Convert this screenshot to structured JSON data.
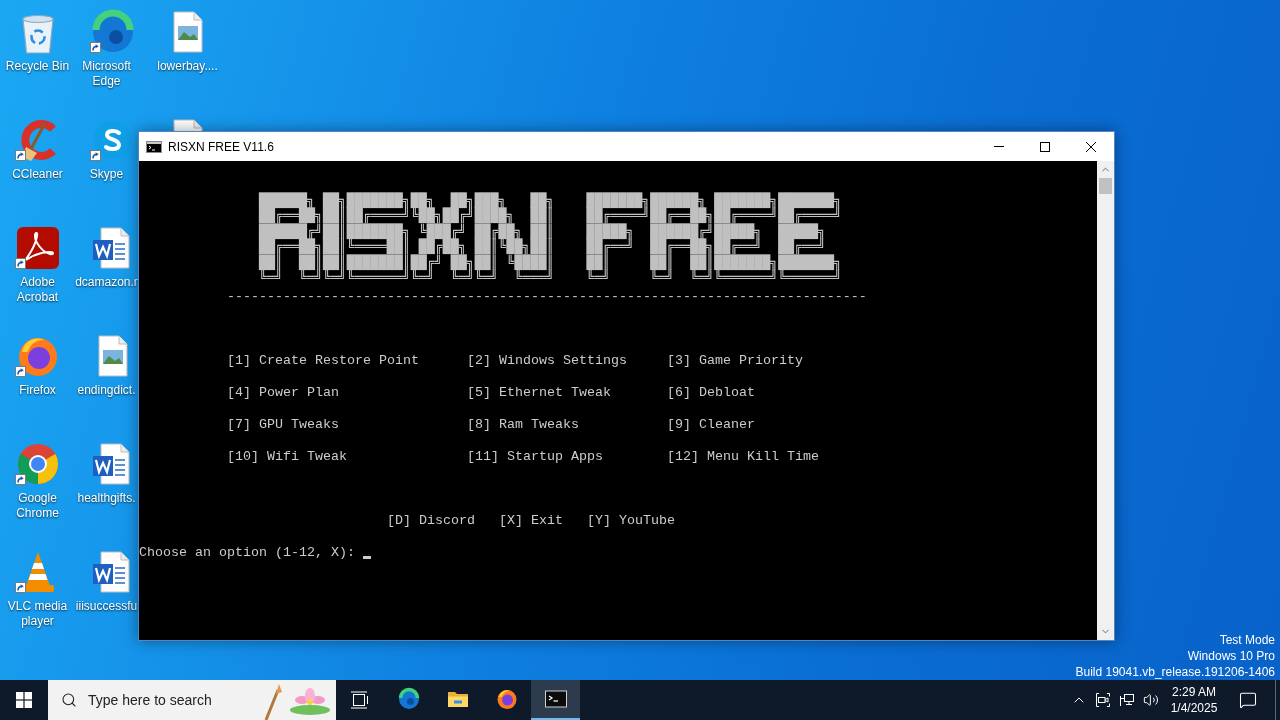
{
  "desktop": {
    "columns": [
      [
        {
          "kind": "recycle-bin",
          "label": "Recycle Bin",
          "shortcut": false,
          "clipped": false
        },
        {
          "kind": "ccleaner",
          "label": "CCleaner",
          "shortcut": true,
          "clipped": false
        },
        {
          "kind": "acrobat",
          "label": "Adobe Acrobat",
          "shortcut": true,
          "clipped": false
        },
        {
          "kind": "firefox",
          "label": "Firefox",
          "shortcut": true,
          "clipped": false
        },
        {
          "kind": "chrome",
          "label": "Google Chrome",
          "shortcut": true,
          "clipped": false
        },
        {
          "kind": "vlc",
          "label": "VLC media player",
          "shortcut": true,
          "clipped": false
        }
      ],
      [
        {
          "kind": "edge",
          "label": "Microsoft Edge",
          "shortcut": true,
          "clipped": false
        },
        {
          "kind": "skype",
          "label": "Skype",
          "shortcut": true,
          "clipped": false
        },
        {
          "kind": "word-doc",
          "label": "dcamazon.r",
          "shortcut": false,
          "clipped": false
        },
        {
          "kind": "image-file",
          "label": "endingdict.",
          "shortcut": false,
          "clipped": false
        },
        {
          "kind": "word-doc",
          "label": "healthgifts.",
          "shortcut": false,
          "clipped": false
        },
        {
          "kind": "word-doc",
          "label": "iiisuccessfu",
          "shortcut": false,
          "clipped": false
        }
      ],
      [
        {
          "kind": "image-file",
          "label": "lowerbay....",
          "shortcut": false,
          "clipped": false
        },
        {
          "kind": "image-file",
          "shortcut": false,
          "clipped": true
        }
      ]
    ],
    "system_info": [
      "Test Mode",
      "Windows 10 Pro",
      "Build 19041.vb_release.191206-1406"
    ]
  },
  "window": {
    "title": "RISXN FREE V11.6",
    "console": {
      "banner": [
        "██████╗ ██╗███████╗██╗  ██╗███╗   ██╗    ███████╗██████╗ ███████╗███████╗",
        "██╔══██╗██║██╔════╝╚██╗██╔╝████╗  ██║    ██╔════╝██╔══██╗██╔════╝██╔════╝",
        "██████╔╝██║███████╗ ╚███╔╝ ██╔██╗ ██║    █████╗  ██████╔╝█████╗  █████╗",
        "██╔══██╗██║╚════██║ ██╔██╗ ██║╚██╗██║    ██╔══╝  ██╔══██╗██╔══╝  ██╔══╝",
        "██║  ██║██║███████║██╔╝ ██╗██║ ╚████║    ██║     ██║  ██║███████╗███████╗",
        "╚═╝  ╚═╝╚═╝╚══════╝╚═╝  ╚═╝╚═╝  ╚═══╝    ╚═╝     ╚═╝  ╚═╝╚══════╝╚══════╝"
      ],
      "separator": "--------------------------------------------------------------------------------",
      "menu": [
        [
          "[1] Create Restore Point",
          "[2] Windows Settings",
          "[3] Game Priority"
        ],
        [
          "[4] Power Plan",
          "[5] Ethernet Tweak",
          "[6] Debloat"
        ],
        [
          "[7] GPU Tweaks",
          "[8] Ram Tweaks",
          "[9] Cleaner"
        ],
        [
          "[10] Wifi Tweak",
          "[11] Startup Apps",
          "[12] Menu Kill Time"
        ]
      ],
      "shortcuts": [
        "[D] Discord",
        "[X] Exit",
        "[Y] YouTube"
      ],
      "prompt": "Choose an option (1-12, X):"
    }
  },
  "taskbar": {
    "search": {
      "placeholder": "Type here to search"
    },
    "apps": [
      {
        "kind": "edge",
        "selected": false
      },
      {
        "kind": "folder",
        "selected": false
      },
      {
        "kind": "firefox",
        "selected": false
      },
      {
        "kind": "console",
        "selected": true
      }
    ],
    "clock": {
      "time": "2:29 AM",
      "date": "1/4/2025"
    }
  }
}
